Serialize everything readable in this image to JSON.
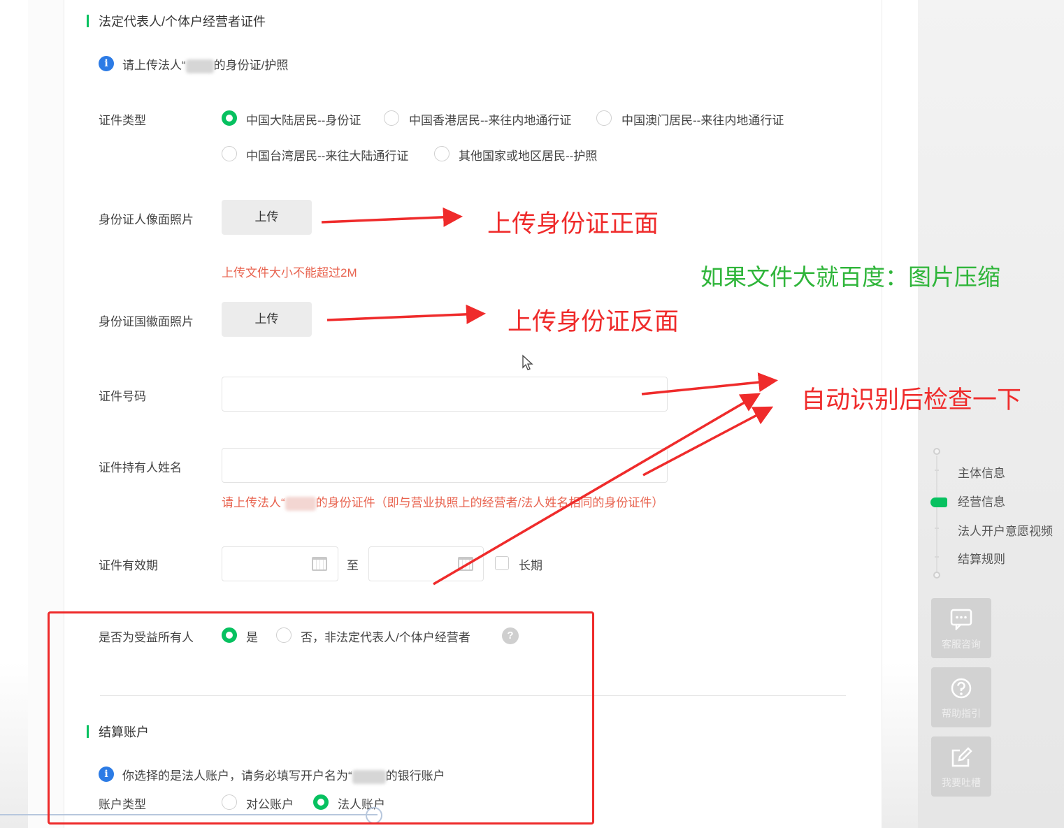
{
  "section_legal": {
    "title": "法定代表人/个体户经营者证件",
    "notice_prefix": "请上传法人“",
    "notice_suffix": "的身份证/护照"
  },
  "id_type": {
    "label": "证件类型",
    "options": [
      {
        "label": "中国大陆居民--身份证",
        "selected": true
      },
      {
        "label": "中国香港居民--来往内地通行证",
        "selected": false
      },
      {
        "label": "中国澳门居民--来往内地通行证",
        "selected": false
      },
      {
        "label": "中国台湾居民--来往大陆通行证",
        "selected": false
      },
      {
        "label": "其他国家或地区居民--护照",
        "selected": false
      }
    ]
  },
  "id_front": {
    "label": "身份证人像面照片",
    "button": "上传",
    "size_hint": "上传文件大小不能超过2M"
  },
  "id_back": {
    "label": "身份证国徽面照片",
    "button": "上传"
  },
  "id_number": {
    "label": "证件号码",
    "value": ""
  },
  "holder_name": {
    "label": "证件持有人姓名",
    "value": "",
    "hint_prefix": "请上传法人“",
    "hint_suffix": "的身份证件（即与营业执照上的经营者/法人姓名相同的身份证件）"
  },
  "validity": {
    "label": "证件有效期",
    "separator": "至",
    "long_term": "长期"
  },
  "beneficiary": {
    "label": "是否为受益所有人",
    "option_yes": "是",
    "option_no": "否，非法定代表人/个体户经营者",
    "help": "?"
  },
  "settlement": {
    "title": "结算账户",
    "notice_prefix": "你选择的是法人账户，请务必填写开户名为“",
    "notice_suffix": "的银行账户",
    "account_type_label": "账户类型",
    "option_corporate": "对公账户",
    "option_legal": "法人账户"
  },
  "steps": [
    "主体信息",
    "经营信息",
    "法人开户意愿视频",
    "结算规则"
  ],
  "active_step": 1,
  "side_buttons": [
    {
      "label": "客服咨询",
      "icon": "chat-icon"
    },
    {
      "label": "帮助指引",
      "icon": "question-icon"
    },
    {
      "label": "我要吐槽",
      "icon": "edit-icon"
    }
  ],
  "annotations": {
    "front": "上传身份证正面",
    "compress": "如果文件大就百度：图片压缩",
    "back": "上传身份证反面",
    "check": "自动识别后检查一下"
  },
  "colors": {
    "accent": "#07c160",
    "info": "#2c7be5",
    "annotation_red": "#ef2b2b",
    "annotation_green": "#2fb53a",
    "hint": "#e8634f"
  }
}
